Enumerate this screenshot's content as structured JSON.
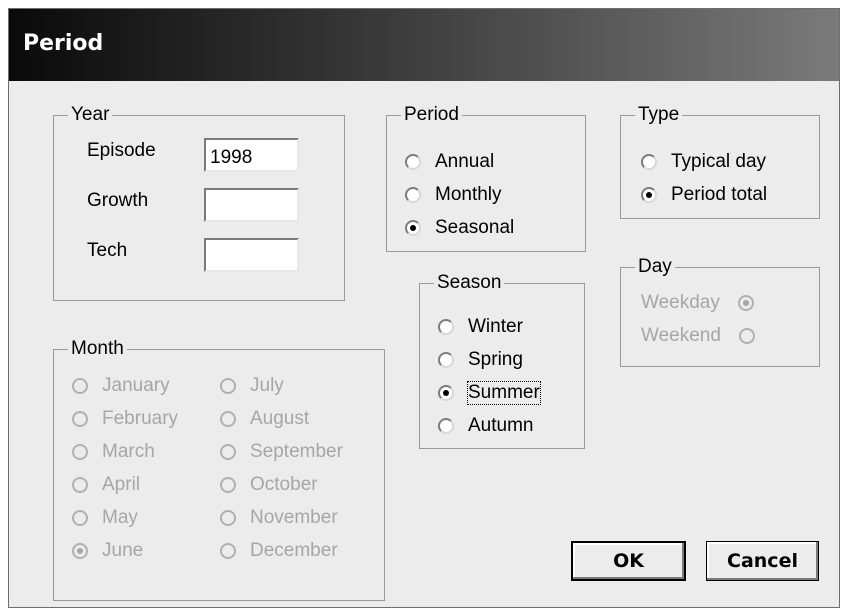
{
  "window": {
    "title": "Period"
  },
  "year": {
    "legend": "Year",
    "fields": [
      {
        "label": "Episode",
        "value": "1998"
      },
      {
        "label": "Growth",
        "value": ""
      },
      {
        "label": "Tech",
        "value": ""
      }
    ]
  },
  "period": {
    "legend": "Period",
    "options": [
      {
        "label": "Annual",
        "checked": false
      },
      {
        "label": "Monthly",
        "checked": false
      },
      {
        "label": "Seasonal",
        "checked": true
      }
    ]
  },
  "type": {
    "legend": "Type",
    "options": [
      {
        "label": "Typical day",
        "checked": false
      },
      {
        "label": "Period total",
        "checked": true
      }
    ]
  },
  "season": {
    "legend": "Season",
    "options": [
      {
        "label": "Winter",
        "checked": false
      },
      {
        "label": "Spring",
        "checked": false
      },
      {
        "label": "Summer",
        "checked": true
      },
      {
        "label": "Autumn",
        "checked": false
      }
    ]
  },
  "day": {
    "legend": "Day",
    "enabled": false,
    "options": [
      {
        "label": "Weekday",
        "checked": true
      },
      {
        "label": "Weekend",
        "checked": false
      }
    ]
  },
  "month": {
    "legend": "Month",
    "enabled": false,
    "options": [
      {
        "label": "January",
        "checked": false
      },
      {
        "label": "February",
        "checked": false
      },
      {
        "label": "March",
        "checked": false
      },
      {
        "label": "April",
        "checked": false
      },
      {
        "label": "May",
        "checked": false
      },
      {
        "label": "June",
        "checked": true
      },
      {
        "label": "July",
        "checked": false
      },
      {
        "label": "August",
        "checked": false
      },
      {
        "label": "September",
        "checked": false
      },
      {
        "label": "October",
        "checked": false
      },
      {
        "label": "November",
        "checked": false
      },
      {
        "label": "December",
        "checked": false
      }
    ]
  },
  "buttons": {
    "ok": "OK",
    "cancel": "Cancel"
  }
}
